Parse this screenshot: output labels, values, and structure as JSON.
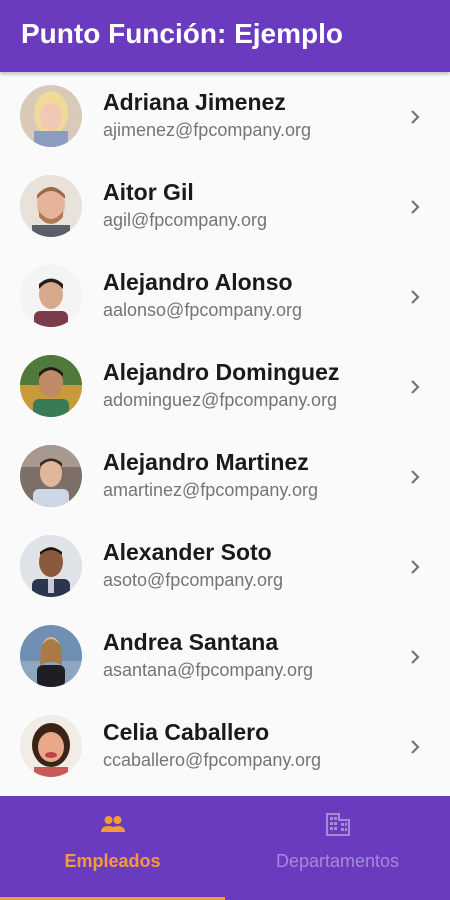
{
  "appbar": {
    "title": "Punto Función: Ejemplo"
  },
  "employees": [
    {
      "name": "Adriana Jimenez",
      "email": "ajimenez@fpcompany.org"
    },
    {
      "name": "Aitor Gil",
      "email": "agil@fpcompany.org"
    },
    {
      "name": "Alejandro Alonso",
      "email": "aalonso@fpcompany.org"
    },
    {
      "name": "Alejandro Dominguez",
      "email": "adominguez@fpcompany.org"
    },
    {
      "name": "Alejandro Martinez",
      "email": "amartinez@fpcompany.org"
    },
    {
      "name": "Alexander Soto",
      "email": "asoto@fpcompany.org"
    },
    {
      "name": "Andrea Santana",
      "email": "asantana@fpcompany.org"
    },
    {
      "name": "Celia Caballero",
      "email": "ccaballero@fpcompany.org"
    }
  ],
  "bottom_nav": {
    "tabs": [
      {
        "label": "Empleados",
        "icon": "people-icon",
        "selected": true
      },
      {
        "label": "Departamentos",
        "icon": "building-icon",
        "selected": false
      }
    ]
  },
  "colors": {
    "primary": "#6a3bbf",
    "accent": "#f39a3a",
    "inactive_tab": "#a58ad6"
  }
}
